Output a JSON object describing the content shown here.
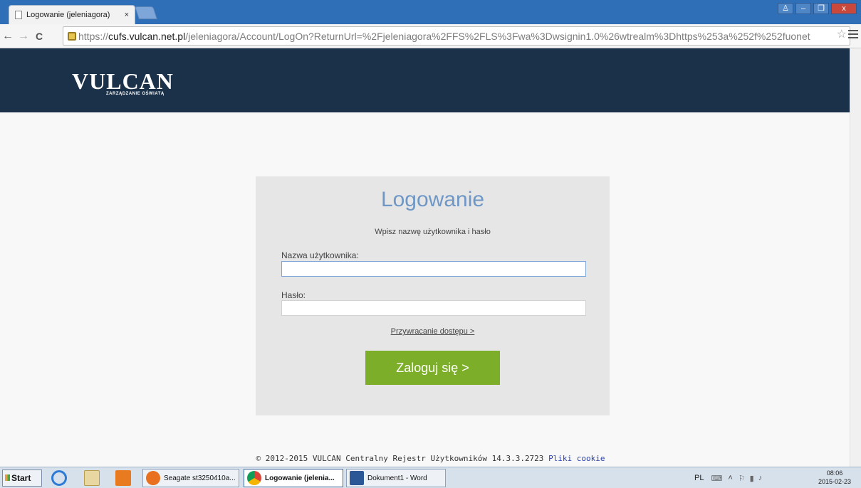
{
  "browser": {
    "tab_title": "Logowanie (jeleniagora)",
    "tab_close": "×",
    "url_proto": "https://",
    "url_host": "cufs.vulcan.net.pl",
    "url_rest": "/jeleniagora/Account/LogOn?ReturnUrl=%2Fjeleniagora%2FFS%2FLS%3Fwa%3Dwsignin1.0%26wtrealm%3Dhttps%253a%252f%252fuonet",
    "back": "←",
    "forward": "→",
    "reload": "C",
    "star": "☆"
  },
  "header": {
    "logo_name": "VULCAN",
    "logo_sub": "ZARZĄDZANIE OŚWIATĄ"
  },
  "login": {
    "title": "Logowanie",
    "subtitle": "Wpisz nazwę użytkownika i hasło",
    "username_label": "Nazwa użytkownika:",
    "username_value": "",
    "password_label": "Hasło:",
    "password_value": "",
    "recover_link": "Przywracanie dostępu >",
    "submit_label": "Zaloguj się >"
  },
  "footer": {
    "text": "© 2012-2015 VULCAN Centralny Rejestr Użytkowników 14.3.3.2723",
    "cookie_link": "Pliki cookie"
  },
  "taskbar": {
    "start": "Start",
    "items": [
      {
        "label": "Seagate st3250410a...",
        "active": false
      },
      {
        "label": "Logowanie (jelenia...",
        "active": true
      },
      {
        "label": "Dokument1 - Word",
        "active": false
      }
    ],
    "lang": "PL",
    "time": "08:06",
    "date": "2015-02-23"
  },
  "colors": {
    "header_bg": "#1b3149",
    "accent_title": "#6f97c6",
    "button_green": "#7cae2a"
  }
}
